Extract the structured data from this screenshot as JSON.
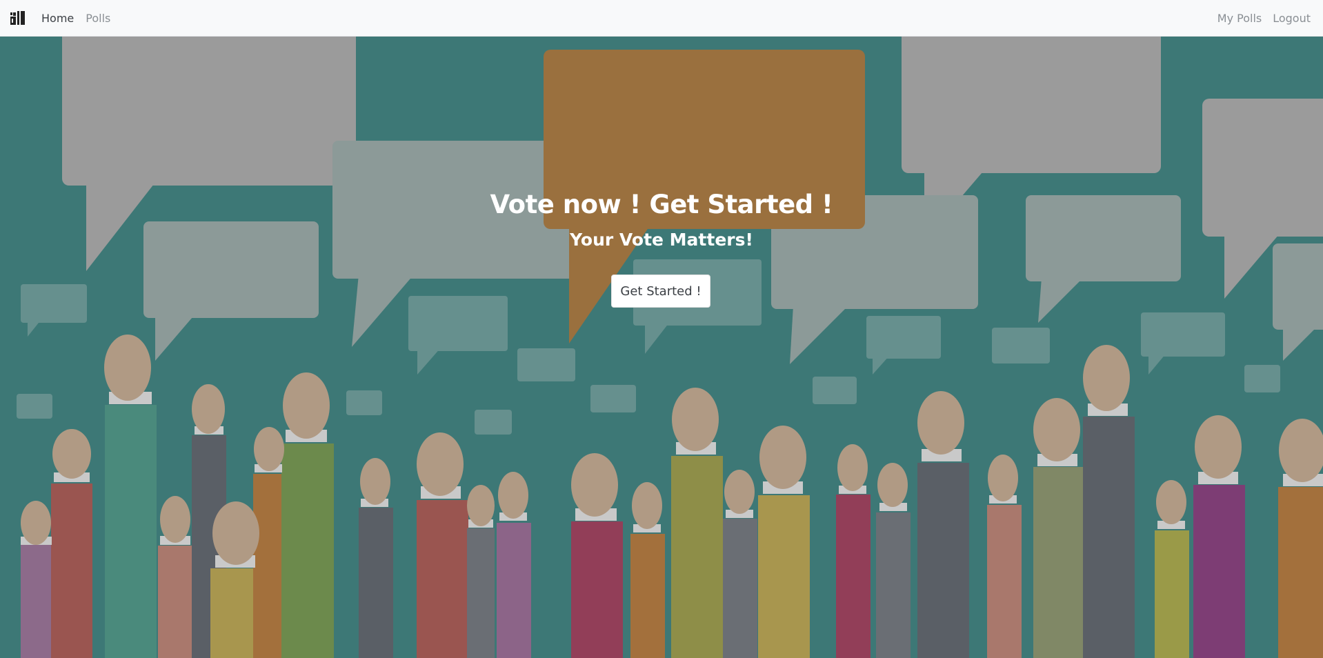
{
  "navbar": {
    "brand_icon": "ballot-box-icon",
    "links": [
      {
        "label": "Home",
        "active": true
      },
      {
        "label": "Polls",
        "active": false
      }
    ],
    "right_links": [
      {
        "label": "My Polls"
      },
      {
        "label": "Logout"
      }
    ]
  },
  "hero": {
    "title": "Vote now ! Get Started !",
    "subtitle": "Your Vote Matters!",
    "cta_label": "Get Started !",
    "background_image": "raised-hands-speech-bubbles-illustration"
  },
  "colors": {
    "navbar_bg": "#f8f9fa",
    "hero_bg": "#3d7876",
    "accent_bubble": "#9a703e",
    "cta_bg": "#ffffff"
  }
}
